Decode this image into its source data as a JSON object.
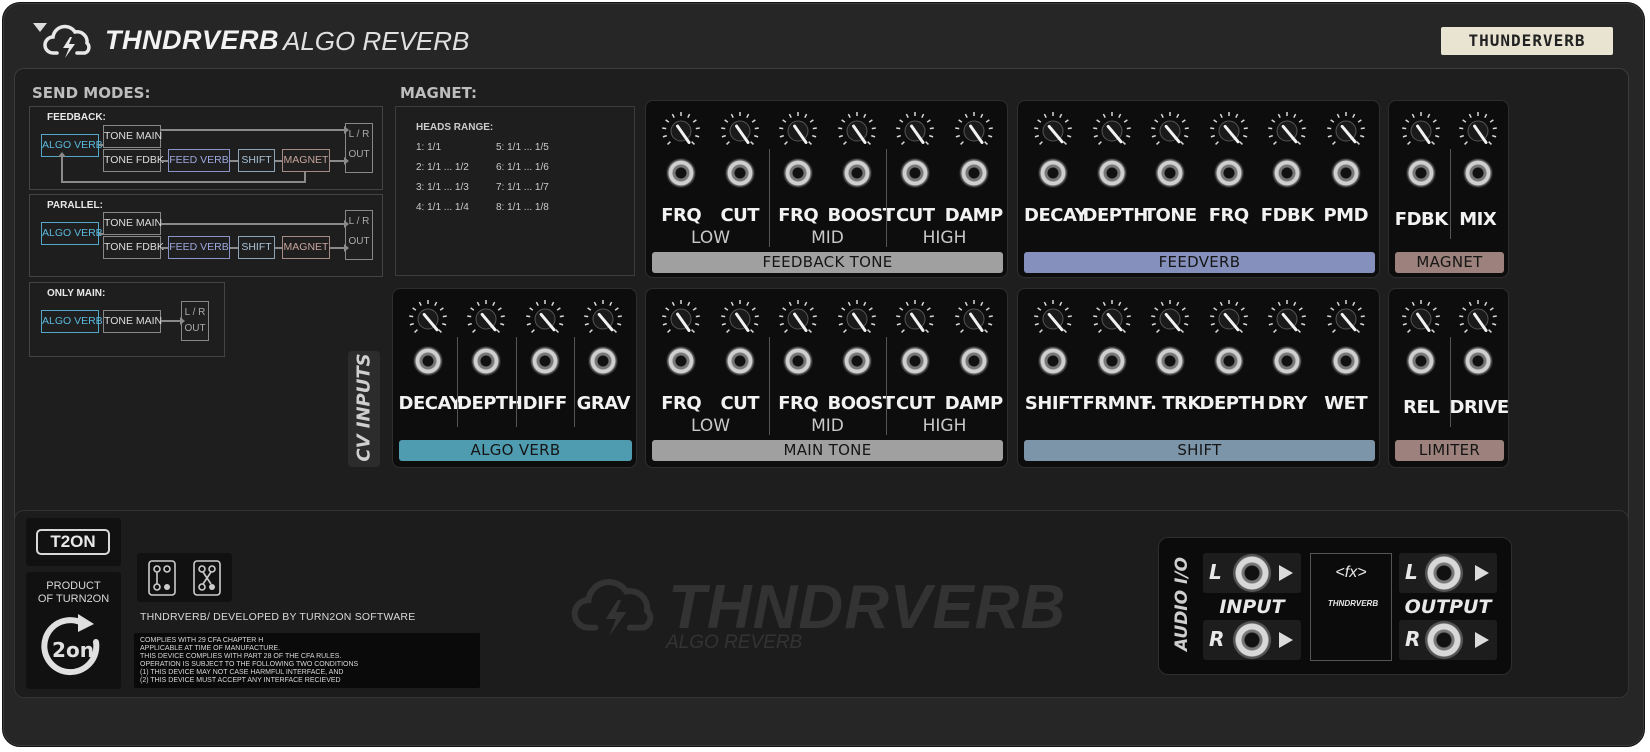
{
  "header": {
    "title": "THNDRVERB",
    "subtitle": "ALGO REVERB",
    "brand_badge": "THUNDERVERB"
  },
  "send_modes": {
    "title": "SEND MODES:",
    "feedback": {
      "title": "FEEDBACK:",
      "nodes": [
        "ALGO VERB",
        "TONE MAIN",
        "TONE FDBK",
        "FEED VERB",
        "SHIFT",
        "MAGNET",
        "L / R",
        "OUT"
      ]
    },
    "parallel": {
      "title": "PARALLEL:",
      "nodes": [
        "ALGO VERB",
        "TONE MAIN",
        "TONE FDBK",
        "FEED VERB",
        "SHIFT",
        "MAGNET",
        "L / R",
        "OUT"
      ]
    },
    "only_main": {
      "title": "ONLY MAIN:",
      "nodes": [
        "ALGO VERB",
        "TONE MAIN",
        "L / R",
        "OUT"
      ]
    }
  },
  "magnet_info": {
    "title": "MAGNET:",
    "heads_title": "HEADS RANGE:",
    "heads": [
      "1: 1/1",
      "2: 1/1 ... 1/2",
      "3: 1/1 ... 1/3",
      "4: 1/1 ... 1/4",
      "5: 1/1 ... 1/5",
      "6: 1/1 ... 1/6",
      "7: 1/1 ... 1/7",
      "8: 1/1 ... 1/8"
    ]
  },
  "modules": {
    "feedback_tone": {
      "label": "FEEDBACK TONE",
      "color": "#a0a0a0",
      "params": [
        "FRQ",
        "CUT",
        "FRQ",
        "BOOST",
        "CUT",
        "DAMP"
      ],
      "bands": [
        "LOW",
        "MID",
        "HIGH"
      ],
      "knob_angles": [
        -35,
        -35,
        -35,
        -35,
        -35,
        -35
      ]
    },
    "feedverb": {
      "label": "FEEDVERB",
      "color": "#8590bd",
      "params": [
        "DECAY",
        "DEPTH",
        "TONE",
        "FRQ",
        "FDBK",
        "PMD"
      ],
      "knob_angles": [
        -40,
        -40,
        -40,
        -40,
        -40,
        -40
      ]
    },
    "magnet": {
      "label": "MAGNET",
      "color": "#9c817c",
      "params": [
        "FDBK",
        "MIX"
      ],
      "knob_angles": [
        -35,
        -35
      ]
    },
    "algo_verb": {
      "label": "ALGO VERB",
      "color": "#4f9bb0",
      "params": [
        "DECAY",
        "DEPTH",
        "DIFF",
        "GRAV"
      ],
      "knob_angles": [
        -40,
        -40,
        -40,
        -40
      ]
    },
    "main_tone": {
      "label": "MAIN TONE",
      "color": "#a0a0a0",
      "params": [
        "FRQ",
        "CUT",
        "FRQ",
        "BOOST",
        "CUT",
        "DAMP"
      ],
      "bands": [
        "LOW",
        "MID",
        "HIGH"
      ],
      "knob_angles": [
        -35,
        -35,
        -35,
        -35,
        -35,
        -35
      ]
    },
    "shift": {
      "label": "SHIFT",
      "color": "#7d95a9",
      "params": [
        "SHIFT",
        "FRMNT",
        "F. TRK",
        "DEPTH",
        "DRY",
        "WET"
      ],
      "knob_angles": [
        -40,
        -40,
        -40,
        -40,
        -40,
        -40
      ]
    },
    "limiter": {
      "label": "LIMITER",
      "color": "#9c817c",
      "params": [
        "REL",
        "DRIVE"
      ],
      "knob_angles": [
        -35,
        -35
      ]
    }
  },
  "cv_inputs_label": "CV INPUTS",
  "footer": {
    "t2on_badge": "T2ON",
    "product_text": "PRODUCT\nOF TURN2ON",
    "product_logo_text": "2on",
    "developed_by": "THNDRVERB/ DEVELOPED BY TURN2ON SOFTWARE",
    "legal": [
      "COMPLIES WITH 29 CFA CHAPTER H",
      "APPLICABLE AT TIME OF MANUFACTURE.",
      "THIS DEVICE COMPLIES WITH PART 28 OF THE CFA RULES.",
      "OPERATION IS SUBJECT TO THE FOLLOWING TWO CONDITIONS",
      "(1) THIS DEVICE MAY NOT CASE HARMFUL INTERFACE, AND",
      "(2) THIS DEVICE MUST ACCEPT ANY INTERFACE RECIEVED"
    ],
    "watermark_title": "THNDRVERB",
    "watermark_sub": "ALGO REVERB"
  },
  "audio_io": {
    "label": "AUDIO I/O",
    "input_label": "INPUT",
    "output_label": "OUTPUT",
    "fx_text": "<fx>",
    "fx_brand": "THNDRVERB",
    "channel_l": "L",
    "channel_r": "R"
  }
}
